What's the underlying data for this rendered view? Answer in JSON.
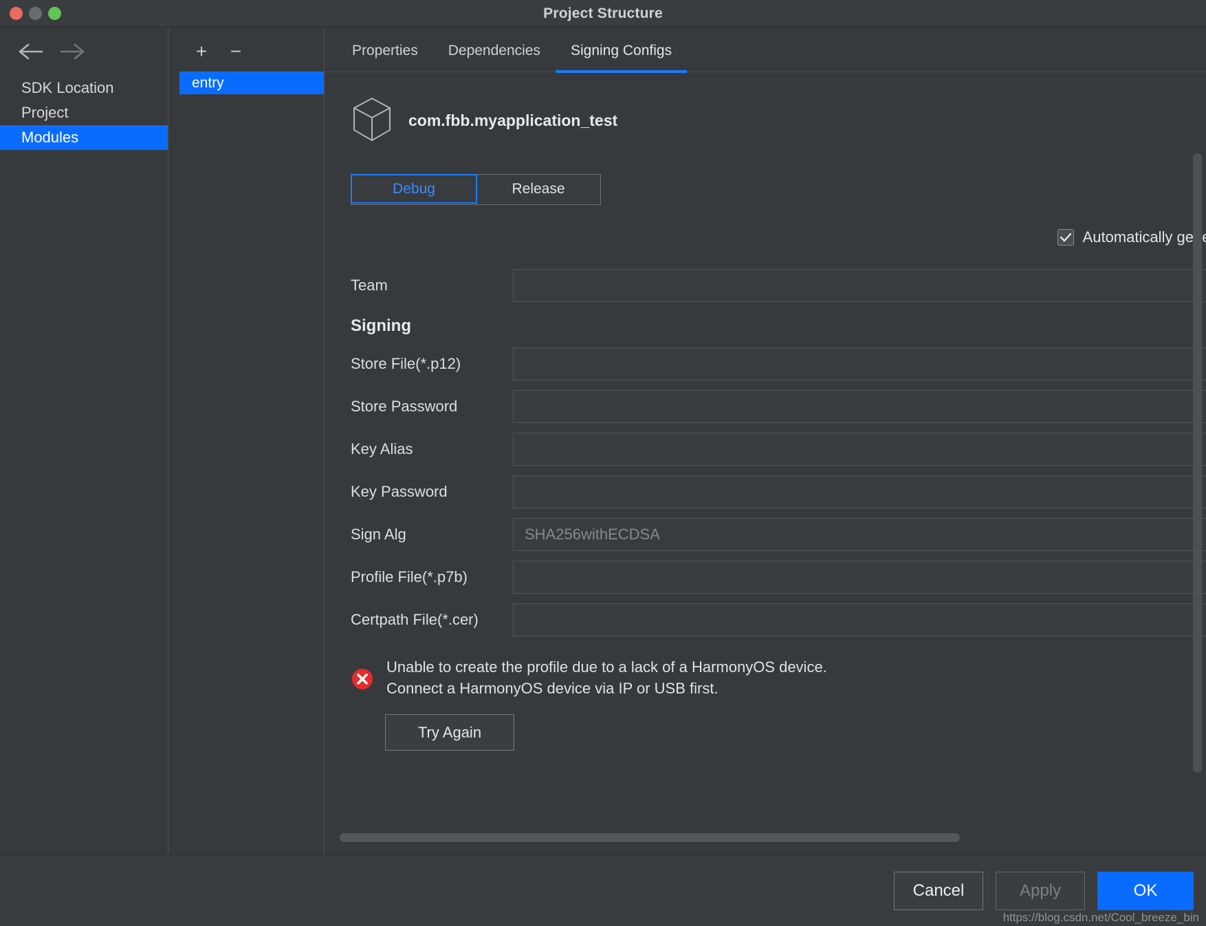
{
  "window": {
    "title": "Project Structure",
    "traffic_lights": [
      "close-red",
      "minimize-gray",
      "maximize-green"
    ]
  },
  "nav": {
    "back_icon": "arrow-left-icon",
    "forward_icon": "arrow-right-icon",
    "items": [
      {
        "label": "SDK Location",
        "selected": false
      },
      {
        "label": "Project",
        "selected": false
      },
      {
        "label": "Modules",
        "selected": true
      }
    ]
  },
  "module_list": {
    "add_label": "+",
    "remove_label": "−",
    "items": [
      {
        "label": "entry",
        "selected": true
      }
    ]
  },
  "content": {
    "tabs": [
      {
        "label": "Properties",
        "active": false
      },
      {
        "label": "Dependencies",
        "active": false
      },
      {
        "label": "Signing Configs",
        "active": true
      }
    ],
    "package": {
      "icon": "cube-3d-icon",
      "name": "com.fbb.myapplication_test"
    },
    "build_variant": {
      "options": [
        {
          "label": "Debug",
          "active": true
        },
        {
          "label": "Release",
          "active": false
        }
      ]
    },
    "auto_generate": {
      "checked": true,
      "label": "Automatically genera"
    },
    "fields": [
      {
        "label": "Team",
        "value": "",
        "placeholder": ""
      },
      {
        "label": "Store File(*.p12)",
        "value": "",
        "placeholder": ""
      },
      {
        "label": "Store Password",
        "value": "",
        "placeholder": ""
      },
      {
        "label": "Key Alias",
        "value": "",
        "placeholder": ""
      },
      {
        "label": "Key Password",
        "value": "",
        "placeholder": ""
      },
      {
        "label": "Sign Alg",
        "value": "",
        "placeholder": "SHA256withECDSA"
      },
      {
        "label": "Profile File(*.p7b)",
        "value": "",
        "placeholder": ""
      },
      {
        "label": "Certpath File(*.cer)",
        "value": "",
        "placeholder": ""
      }
    ],
    "signing_section_title": "Signing",
    "error": {
      "icon": "error-circle-icon",
      "line1": "Unable to create the profile due to a lack of a HarmonyOS device.",
      "line2": "Connect a HarmonyOS device via IP or USB first."
    },
    "try_again_label": "Try Again"
  },
  "footer": {
    "cancel_label": "Cancel",
    "apply_label": "Apply",
    "ok_label": "OK",
    "watermark": "https://blog.csdn.net/Cool_breeze_bin"
  },
  "colors": {
    "accent": "#0a6cff",
    "tab_underline": "#1a7cff",
    "error_red": "#e52b2b",
    "window_bg": "#373a3d"
  }
}
